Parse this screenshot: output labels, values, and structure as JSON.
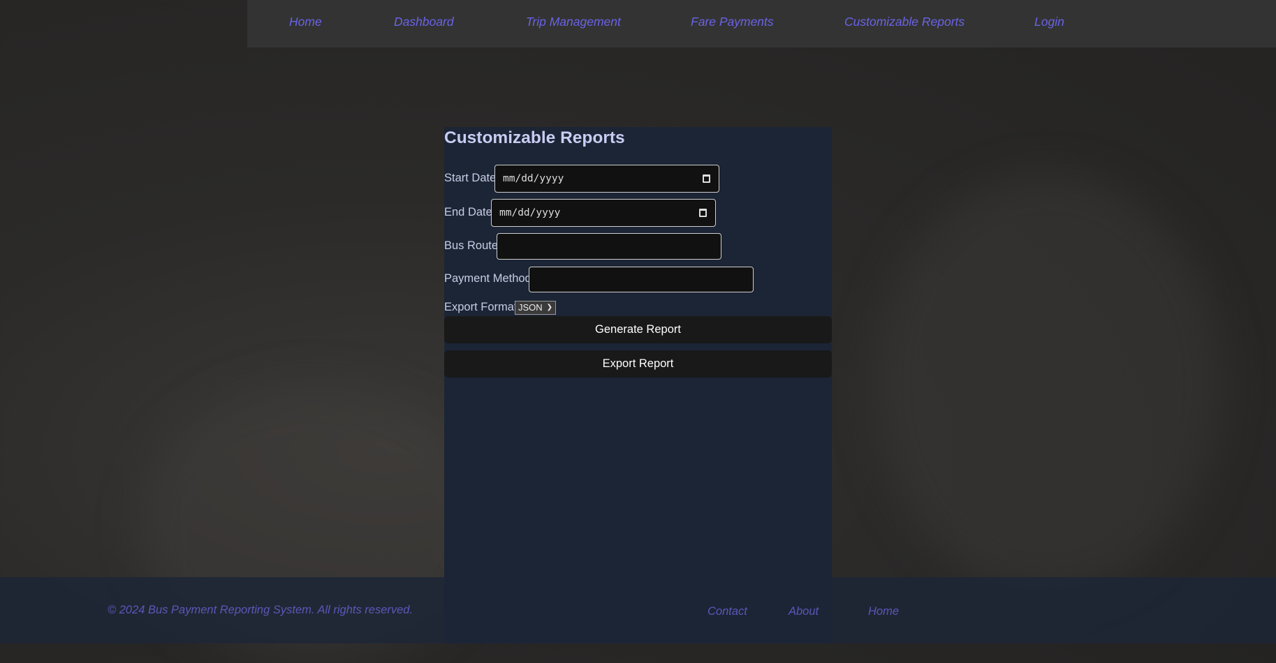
{
  "nav": {
    "items": [
      "Home",
      "Dashboard",
      "Trip Management",
      "Fare Payments",
      "Customizable Reports",
      "Login"
    ],
    "link_color": "#6a63e6"
  },
  "form": {
    "title": "Customizable Reports",
    "start_date": {
      "label": "Start Date",
      "placeholder": "mm/dd/yyyy"
    },
    "end_date": {
      "label": "End Date",
      "placeholder": "mm/dd/yyyy"
    },
    "bus_route": {
      "label": "Bus Route",
      "value": ""
    },
    "payment_method": {
      "label": "Payment Method",
      "value": ""
    },
    "export_format": {
      "label": "Export Format",
      "selected": "JSON"
    },
    "generate_label": "Generate Report",
    "export_label": "Export Report"
  },
  "footer": {
    "copyright": "© 2024 Bus Payment Reporting System. All rights reserved.",
    "links": [
      "Contact",
      "About",
      "Home"
    ]
  }
}
